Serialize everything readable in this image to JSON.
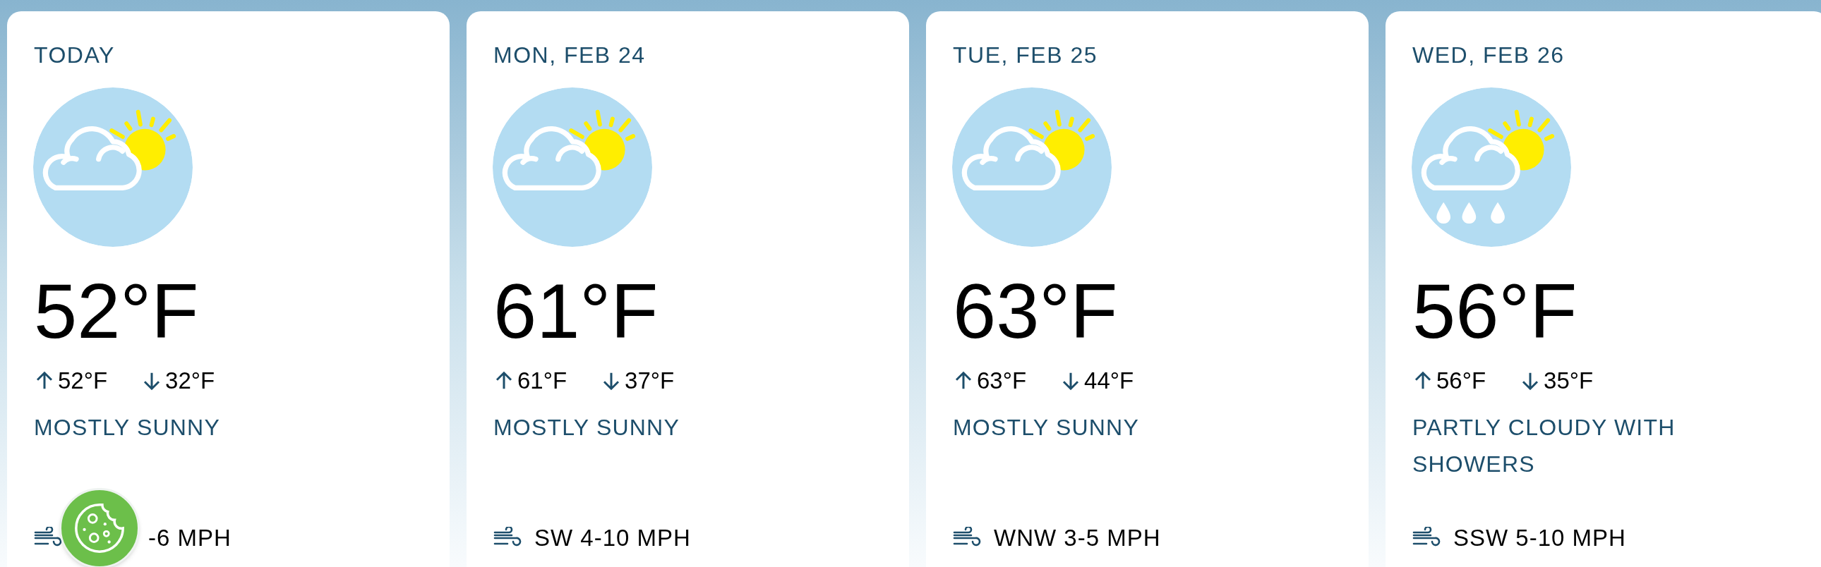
{
  "forecast": [
    {
      "date": "TODAY",
      "kind": "sun_cloud",
      "temperature": "52°F",
      "high": "52°F",
      "low": "32°F",
      "condition": "MOSTLY SUNNY",
      "wind": "-6 MPH"
    },
    {
      "date": "MON, FEB 24",
      "kind": "sun_cloud",
      "temperature": "61°F",
      "high": "61°F",
      "low": "37°F",
      "condition": "MOSTLY SUNNY",
      "wind": "SW 4-10 MPH"
    },
    {
      "date": "TUE, FEB 25",
      "kind": "sun_cloud",
      "temperature": "63°F",
      "high": "63°F",
      "low": "44°F",
      "condition": "MOSTLY SUNNY",
      "wind": "WNW 3-5 MPH"
    },
    {
      "date": "WED, FEB 26",
      "kind": "sun_cloud_rain",
      "temperature": "56°F",
      "high": "56°F",
      "low": "35°F",
      "condition": "PARTLY CLOUDY WITH SHOWERS",
      "wind": "SSW 5-10 MPH"
    }
  ],
  "cookie_button": {
    "kind": "cookie"
  }
}
